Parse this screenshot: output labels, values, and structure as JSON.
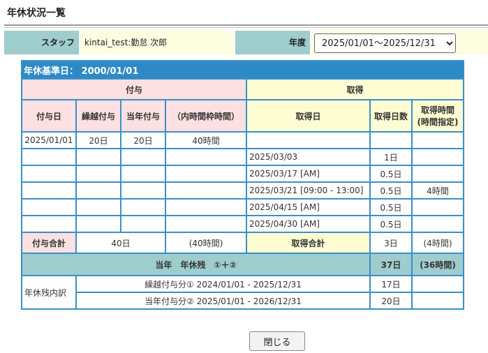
{
  "page_title": "年休状況一覧",
  "filter": {
    "staff_label": "スタッフ",
    "staff_value": "kintai_test:勤怠 次郎",
    "year_label": "年度",
    "year_value": "2025/01/01～2025/12/31"
  },
  "table": {
    "base_date": "年休基準日： 2000/01/01",
    "grant_header": "付与",
    "taken_header": "取得",
    "columns": {
      "grant_date": "付与日",
      "carryover": "繰越付与",
      "current_grant": "当年付与",
      "hourly_frame": "（内時間枠時間）",
      "taken_date": "取得日",
      "taken_days": "取得日数",
      "taken_hours_l1": "取得時間",
      "taken_hours_l2": "(時間指定)"
    },
    "rows": [
      {
        "grant_date": "2025/01/01",
        "carryover": "20日",
        "current_grant": "20日",
        "hourly_frame": "40時間",
        "taken_date": "",
        "taken_days": "",
        "taken_hours": ""
      },
      {
        "grant_date": "",
        "carryover": "",
        "current_grant": "",
        "hourly_frame": "",
        "taken_date": "2025/03/03",
        "taken_days": "1日",
        "taken_hours": ""
      },
      {
        "grant_date": "",
        "carryover": "",
        "current_grant": "",
        "hourly_frame": "",
        "taken_date": "2025/03/17 [AM]",
        "taken_days": "0.5日",
        "taken_hours": ""
      },
      {
        "grant_date": "",
        "carryover": "",
        "current_grant": "",
        "hourly_frame": "",
        "taken_date": "2025/03/21 [09:00 - 13:00]",
        "taken_days": "0.5日",
        "taken_hours": "4時間"
      },
      {
        "grant_date": "",
        "carryover": "",
        "current_grant": "",
        "hourly_frame": "",
        "taken_date": "2025/04/15 [AM]",
        "taken_days": "0.5日",
        "taken_hours": ""
      },
      {
        "grant_date": "",
        "carryover": "",
        "current_grant": "",
        "hourly_frame": "",
        "taken_date": "2025/04/30 [AM]",
        "taken_days": "0.5日",
        "taken_hours": ""
      }
    ],
    "totals": {
      "grant_total_label": "付与合計",
      "grant_total_days": "40日",
      "grant_total_hours": "(40時間)",
      "taken_total_label": "取得合計",
      "taken_total_days": "3日",
      "taken_total_hours": "(4時間)"
    },
    "remaining": {
      "label": "当年　年休残　①＋②",
      "days": "37日",
      "hours": "(36時間)"
    },
    "breakdown": {
      "label": "年休残内訳",
      "rows": [
        {
          "label": "繰越付与分① 2024/01/01 - 2025/12/31",
          "days": "17日",
          "hours": ""
        },
        {
          "label": "当年付与分② 2025/01/01 - 2026/12/31",
          "days": "20日",
          "hours": ""
        }
      ]
    }
  },
  "close_label": "閉じる"
}
